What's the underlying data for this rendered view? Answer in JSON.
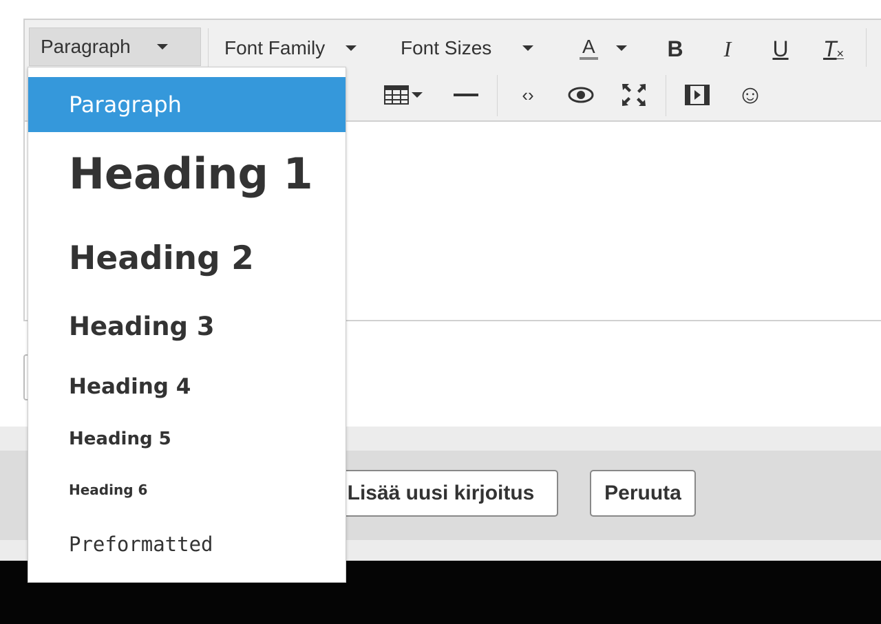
{
  "toolbar": {
    "format_select": "Paragraph",
    "font_family": "Font Family",
    "font_sizes": "Font Sizes",
    "text_color_letter": "A",
    "bold": "B",
    "italic": "I",
    "underline": "U",
    "clear_format": "T"
  },
  "format_menu": {
    "items": [
      "Paragraph",
      "Heading 1",
      "Heading 2",
      "Heading 3",
      "Heading 4",
      "Heading 5",
      "Heading 6",
      "Preformatted"
    ],
    "selected": "Paragraph"
  },
  "actions": {
    "add_post": "Lisää uusi kirjoitus",
    "cancel": "Peruuta"
  },
  "colors": {
    "accent": "#3598db",
    "toolbar_bg": "#f0f0f0"
  }
}
